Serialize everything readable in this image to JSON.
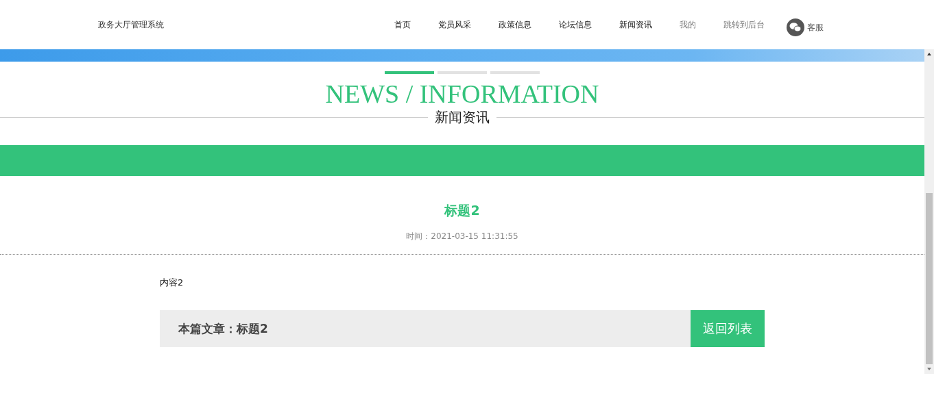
{
  "header": {
    "brand": "政务大厅管理系统",
    "nav": [
      {
        "label": "首页",
        "muted": false
      },
      {
        "label": "党员风采",
        "muted": false
      },
      {
        "label": "政策信息",
        "muted": false
      },
      {
        "label": "论坛信息",
        "muted": false
      },
      {
        "label": "新闻资讯",
        "muted": false
      },
      {
        "label": "我的",
        "muted": true
      },
      {
        "label": "跳转到后台",
        "muted": true
      }
    ],
    "service": "客服"
  },
  "carousel_indicators": [
    {
      "selected": true
    },
    {
      "selected": false
    },
    {
      "selected": false
    }
  ],
  "section": {
    "title_en": "NEWS / INFORMATION",
    "title_cn": "新闻资讯"
  },
  "article": {
    "title": "标题2",
    "time": "时间：2021-03-15 11:31:55",
    "content": "内容2",
    "footer_label": "本篇文章：标题2",
    "back_button": "返回列表"
  }
}
